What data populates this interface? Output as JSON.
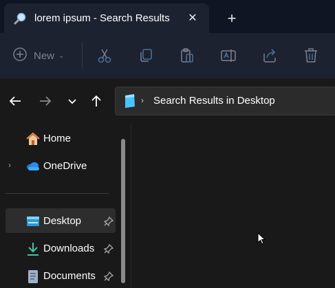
{
  "tab": {
    "title": "lorem ipsum - Search Results",
    "close_glyph": "✕",
    "new_tab_glyph": "+"
  },
  "command_bar": {
    "new_label": "New",
    "new_chevron": "⌄",
    "buttons": [
      "cut-icon",
      "copy-icon",
      "paste-icon",
      "rename-icon",
      "share-icon",
      "delete-icon"
    ]
  },
  "address": {
    "chevron": "›",
    "path": "Search Results in Desktop"
  },
  "nav_pane": {
    "items": [
      {
        "label": "Home",
        "icon": "home-icon"
      },
      {
        "label": "OneDrive",
        "icon": "onedrive-icon",
        "expander": "›"
      },
      {
        "label": "Desktop",
        "icon": "desktop-folder-icon",
        "pinned": true,
        "selected": true
      },
      {
        "label": "Downloads",
        "icon": "downloads-icon",
        "pinned": true
      },
      {
        "label": "Documents",
        "icon": "documents-icon",
        "pinned": true
      }
    ]
  },
  "colors": {
    "titlebar_bg": "#0f1523",
    "tab_bg": "#1c2230",
    "content_bg": "#191919",
    "accent": "#4cc2ff"
  }
}
